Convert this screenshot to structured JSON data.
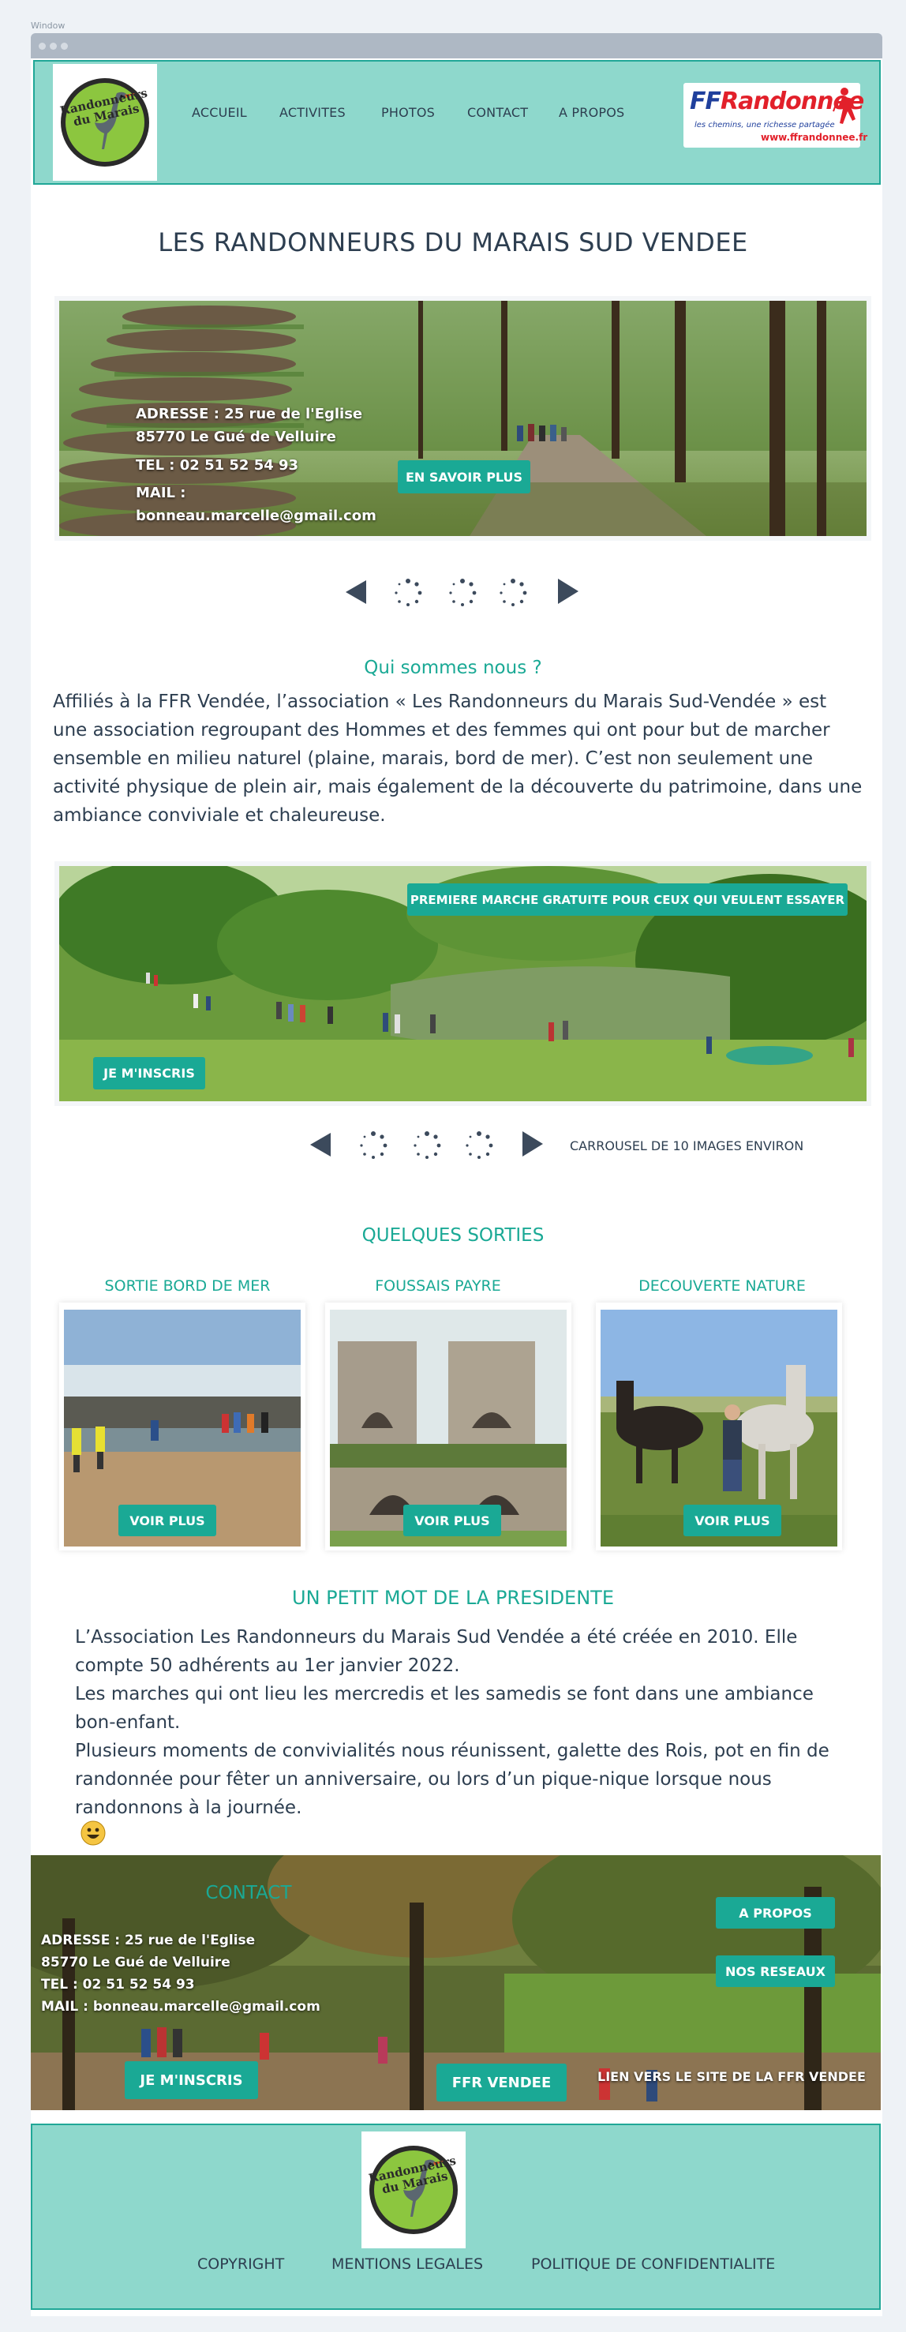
{
  "window": {
    "label": "Window"
  },
  "header": {
    "logo_text_1": "Randonneurs",
    "logo_text_2": "du Marais",
    "nav": [
      "ACCUEIL",
      "ACTIVITES",
      "PHOTOS",
      "CONTACT",
      "A PROPOS"
    ],
    "ffr_brand_ff": "FF",
    "ffr_brand_name": "Randonnée",
    "ffr_tagline": "les chemins, une richesse partagée",
    "ffr_url": "www.ffrandonnee.fr"
  },
  "main_title": "LES RANDONNEURS DU MARAIS SUD VENDEE",
  "hero": {
    "address_line1": "ADRESSE :  25 rue de   l'Eglise",
    "address_line2": "85770 Le Gué de Velluire",
    "tel": "TEL : 02 51 52 54 93",
    "mail_label": "MAIL :",
    "mail_value": "bonneau.marcelle@gmail.com",
    "button": "EN SAVOIR PLUS"
  },
  "about": {
    "title": "Qui sommes nous ?",
    "lines": [
      "Affiliés à la FFR Vendée, l’association « Les Randonneurs du Marais Sud-Vendée » est",
      "une association regroupant des Hommes et des femmes qui ont pour but de marcher",
      "ensemble en milieu naturel (plaine, marais, bord de mer). C’est non seulement une",
      "activité physique de plein air, mais également de la découverte du patrimoine, dans une",
      "ambiance conviviale et chaleureuse."
    ]
  },
  "carousel": {
    "promo_button": "PREMIERE MARCHE GRATUITE POUR CEUX QUI VEULENT ESSAYER",
    "signup_button": "JE M'INSCRIS",
    "caption": "CARROUSEL DE 10 IMAGES ENVIRON"
  },
  "outings": {
    "title": "QUELQUES SORTIES",
    "items": [
      {
        "title": "SORTIE BORD DE MER",
        "button": "VOIR PLUS"
      },
      {
        "title": "FOUSSAIS PAYRE",
        "button": "VOIR PLUS"
      },
      {
        "title": "DECOUVERTE NATURE",
        "button": "VOIR PLUS"
      }
    ]
  },
  "president": {
    "title": "UN PETIT MOT DE LA PRESIDENTE",
    "lines": [
      "L’Association Les Randonneurs du Marais Sud Vendée a été créée en 2010. Elle",
      "compte 50 adhérents au 1er janvier 2022.",
      "Les marches qui ont lieu les mercredis et les samedis se font dans une ambiance",
      "bon-enfant.",
      "Plusieurs moments de convivialités nous réunissent, galette des Rois, pot en fin de",
      "randonnée pour fêter un anniversaire, ou lors d’un pique-nique lorsque nous",
      "randonnons à la journée."
    ],
    "emoji": "😃"
  },
  "contact": {
    "title": "CONTACT",
    "address_line1": "ADRESSE :  25 rue de l'Eglise",
    "address_line2": "85770 Le Gué de Velluire",
    "tel": "TEL : 02 51 52 54 93",
    "mail": "MAIL : bonneau.marcelle@gmail.com",
    "signup_button": "JE M'INSCRIS",
    "ffr_button": "FFR VENDEE",
    "ffr_caption": "LIEN VERS LE SITE DE LA FFR VENDEE",
    "about_button": "A PROPOS",
    "social_button": "NOS RESEAUX"
  },
  "footer": {
    "links": [
      "COPYRIGHT",
      "MENTIONS LEGALES",
      "POLITIQUE DE CONFIDENTIALITE"
    ]
  },
  "colors": {
    "teal": "#1aa995",
    "mint": "#8ed8cc",
    "navy": "#2d3e50",
    "ffr_blue": "#1f3f9c",
    "ffr_red": "#e2202a"
  }
}
